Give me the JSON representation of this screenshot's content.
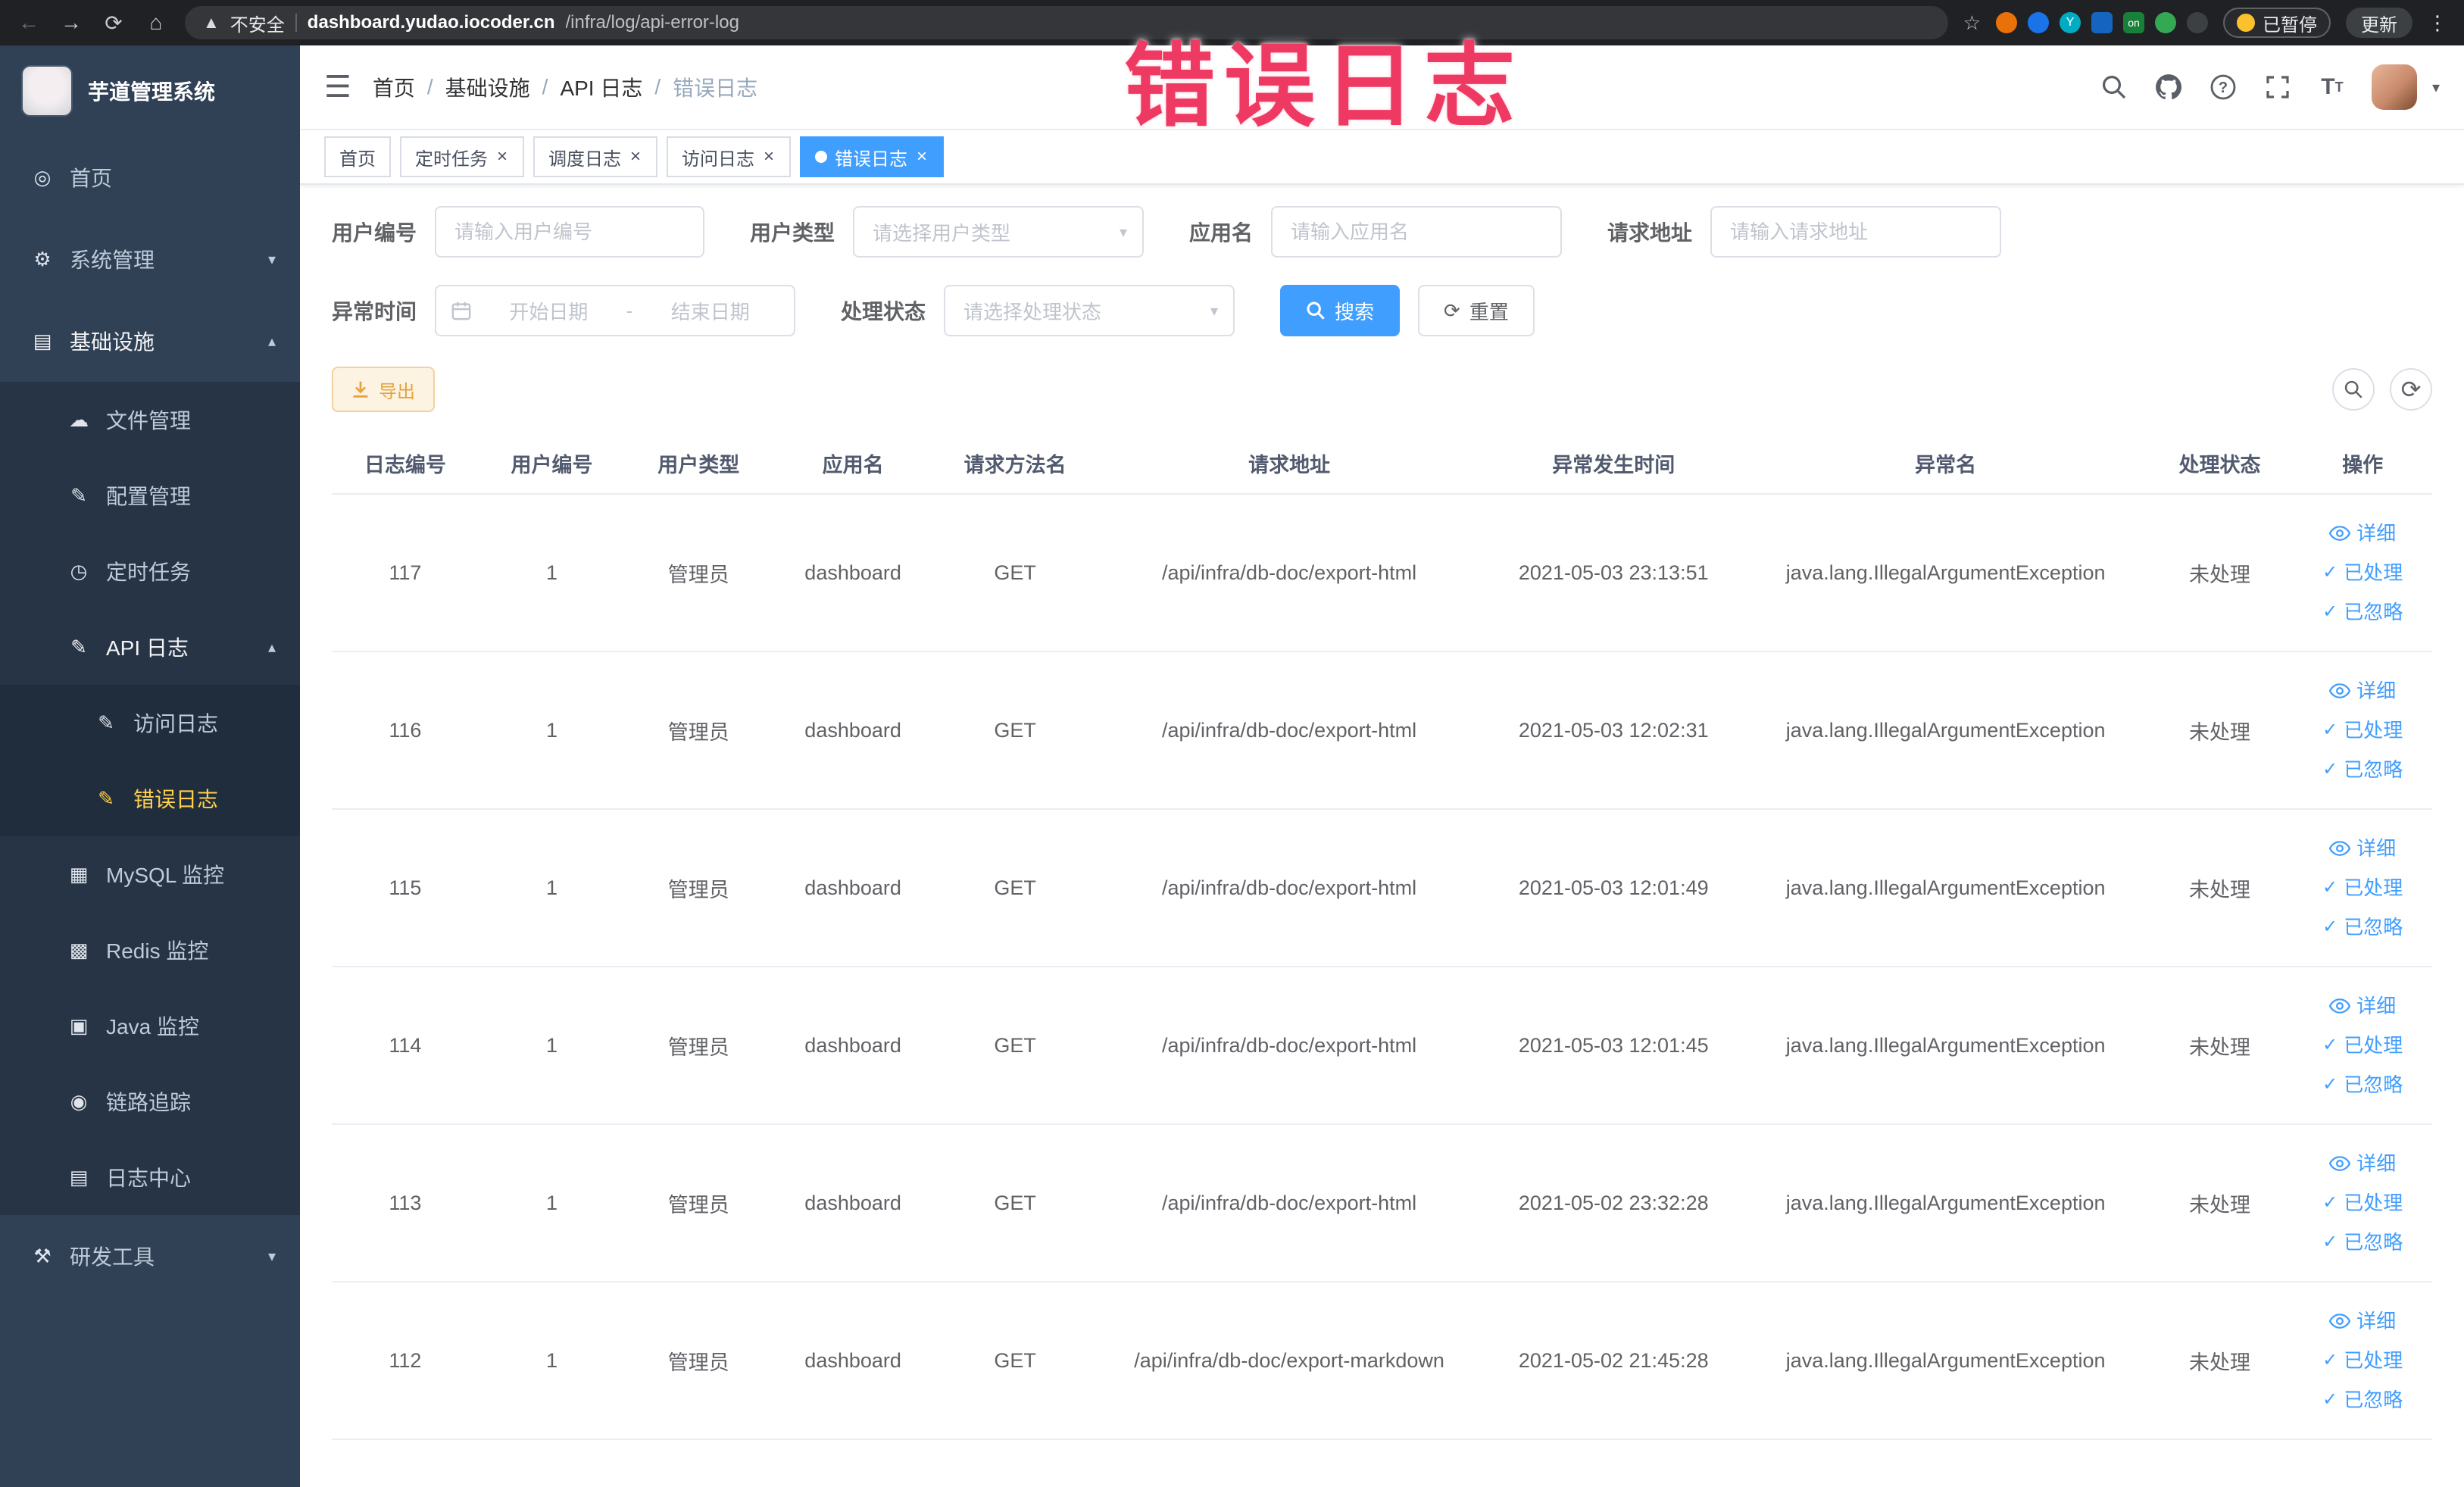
{
  "browser": {
    "security_label": "不安全",
    "url_domain": "dashboard.yudao.iocoder.cn",
    "url_path": "/infra/log/api-error-log",
    "ext_on_label": "on",
    "ext_y_label": "Y",
    "paused_label": "已暂停",
    "update_label": "更新"
  },
  "annotation": {
    "text": "错误日志",
    "color": "#ee3a63"
  },
  "sidebar": {
    "title": "芋道管理系统",
    "items": [
      {
        "key": "home",
        "label": "首页",
        "icon": "home-icon",
        "level": 1
      },
      {
        "key": "system-management",
        "label": "系统管理",
        "icon": "gear-icon",
        "level": 1,
        "expandable": true,
        "expanded": false
      },
      {
        "key": "infrastructure",
        "label": "基础设施",
        "icon": "infrastructure-icon",
        "level": 1,
        "expandable": true,
        "expanded": true,
        "active": true
      },
      {
        "key": "file-management",
        "label": "文件管理",
        "icon": "file-icon",
        "level": 2
      },
      {
        "key": "config-management",
        "label": "配置管理",
        "icon": "config-icon",
        "level": 2
      },
      {
        "key": "scheduled-tasks",
        "label": "定时任务",
        "icon": "timer-icon",
        "level": 2
      },
      {
        "key": "api-log",
        "label": "API 日志",
        "icon": "api-log-icon",
        "level": 2,
        "expandable": true,
        "expanded": true,
        "active": true
      },
      {
        "key": "access-log",
        "label": "访问日志",
        "icon": "access-log-icon",
        "level": 3
      },
      {
        "key": "error-log",
        "label": "错误日志",
        "icon": "error-log-icon",
        "level": 3,
        "selected": true
      },
      {
        "key": "mysql-monitor",
        "label": "MySQL 监控",
        "icon": "mysql-icon",
        "level": 2
      },
      {
        "key": "redis-monitor",
        "label": "Redis 监控",
        "icon": "redis-icon",
        "level": 2
      },
      {
        "key": "java-monitor",
        "label": "Java 监控",
        "icon": "java-icon",
        "level": 2
      },
      {
        "key": "link-tracing",
        "label": "链路追踪",
        "icon": "trace-icon",
        "level": 2
      },
      {
        "key": "log-center",
        "label": "日志中心",
        "icon": "log-center-icon",
        "level": 2
      },
      {
        "key": "dev-tools",
        "label": "研发工具",
        "icon": "devtools-icon",
        "level": 1,
        "expandable": true,
        "expanded": false
      }
    ]
  },
  "header": {
    "breadcrumb": [
      "首页",
      "基础设施",
      "API 日志",
      "错误日志"
    ]
  },
  "tabs": [
    {
      "key": "home",
      "label": "首页",
      "closable": false,
      "active": false
    },
    {
      "key": "scheduled-tasks",
      "label": "定时任务",
      "closable": true,
      "active": false
    },
    {
      "key": "job-log",
      "label": "调度日志",
      "closable": true,
      "active": false
    },
    {
      "key": "access-log",
      "label": "访问日志",
      "closable": true,
      "active": false
    },
    {
      "key": "error-log",
      "label": "错误日志",
      "closable": true,
      "active": true
    }
  ],
  "filters": {
    "user_id": {
      "label": "用户编号",
      "placeholder": "请输入用户编号"
    },
    "user_type": {
      "label": "用户类型",
      "placeholder": "请选择用户类型"
    },
    "app_name": {
      "label": "应用名",
      "placeholder": "请输入应用名"
    },
    "request_url": {
      "label": "请求地址",
      "placeholder": "请输入请求地址"
    },
    "exception_time": {
      "label": "异常时间",
      "start_placeholder": "开始日期",
      "separator": "-",
      "end_placeholder": "结束日期"
    },
    "process_status": {
      "label": "处理状态",
      "placeholder": "请选择处理状态"
    },
    "search_button": "搜索",
    "reset_button": "重置"
  },
  "toolbar": {
    "export_button": "导出"
  },
  "table": {
    "columns": [
      "日志编号",
      "用户编号",
      "用户类型",
      "应用名",
      "请求方法名",
      "请求地址",
      "异常发生时间",
      "异常名",
      "处理状态",
      "操作"
    ],
    "row_actions": [
      "详细",
      "已处理",
      "已忽略"
    ],
    "rows": [
      [
        "117",
        "1",
        "管理员",
        "dashboard",
        "GET",
        "/api/infra/db-doc/export-html",
        "2021-05-03 23:13:51",
        "java.lang.IllegalArgumentException",
        "未处理"
      ],
      [
        "116",
        "1",
        "管理员",
        "dashboard",
        "GET",
        "/api/infra/db-doc/export-html",
        "2021-05-03 12:02:31",
        "java.lang.IllegalArgumentException",
        "未处理"
      ],
      [
        "115",
        "1",
        "管理员",
        "dashboard",
        "GET",
        "/api/infra/db-doc/export-html",
        "2021-05-03 12:01:49",
        "java.lang.IllegalArgumentException",
        "未处理"
      ],
      [
        "114",
        "1",
        "管理员",
        "dashboard",
        "GET",
        "/api/infra/db-doc/export-html",
        "2021-05-03 12:01:45",
        "java.lang.IllegalArgumentException",
        "未处理"
      ],
      [
        "113",
        "1",
        "管理员",
        "dashboard",
        "GET",
        "/api/infra/db-doc/export-html",
        "2021-05-02 23:32:28",
        "java.lang.IllegalArgumentException",
        "未处理"
      ],
      [
        "112",
        "1",
        "管理员",
        "dashboard",
        "GET",
        "/api/infra/db-doc/export-markdown",
        "2021-05-02 21:45:28",
        "java.lang.IllegalArgumentException",
        "未处理"
      ]
    ]
  },
  "colors": {
    "accent": "#409eff",
    "sidebar_bg": "#304156",
    "sidebar_active_text": "#ffd04b",
    "warning_text": "#e6a23c",
    "annotation_pink": "#ee3a63"
  }
}
